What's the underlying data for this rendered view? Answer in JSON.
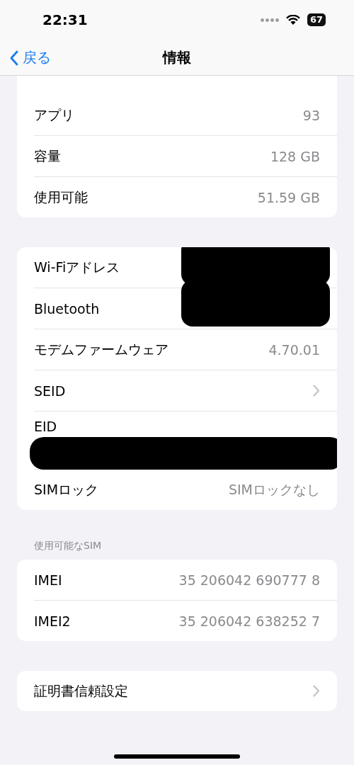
{
  "status_bar": {
    "time": "22:31",
    "battery": "67"
  },
  "nav": {
    "back": "戻る",
    "title": "情報"
  },
  "sections": [
    {
      "rows": [
        {
          "label": "アプリ",
          "value": "93",
          "kind": "value"
        },
        {
          "label": "容量",
          "value": "128 GB",
          "kind": "value"
        },
        {
          "label": "使用可能",
          "value": "51.59 GB",
          "kind": "value"
        }
      ]
    },
    {
      "rows": [
        {
          "label": "Wi-Fiアドレス",
          "kind": "redacted"
        },
        {
          "label": "Bluetooth",
          "kind": "redacted"
        },
        {
          "label": "モデムファームウェア",
          "value": "4.70.01",
          "kind": "value"
        },
        {
          "label": "SEID",
          "kind": "chevron"
        },
        {
          "label": "EID",
          "kind": "redacted_below"
        },
        {
          "label": "SIMロック",
          "value": "SIMロックなし",
          "kind": "value"
        }
      ]
    },
    {
      "header": "使用可能なSIM",
      "rows": [
        {
          "label": "IMEI",
          "value": "35 206042 690777 8",
          "kind": "value"
        },
        {
          "label": "IMEI2",
          "value": "35 206042 638252 7",
          "kind": "value"
        }
      ]
    },
    {
      "rows": [
        {
          "label": "証明書信頼設定",
          "kind": "chevron"
        }
      ]
    }
  ]
}
